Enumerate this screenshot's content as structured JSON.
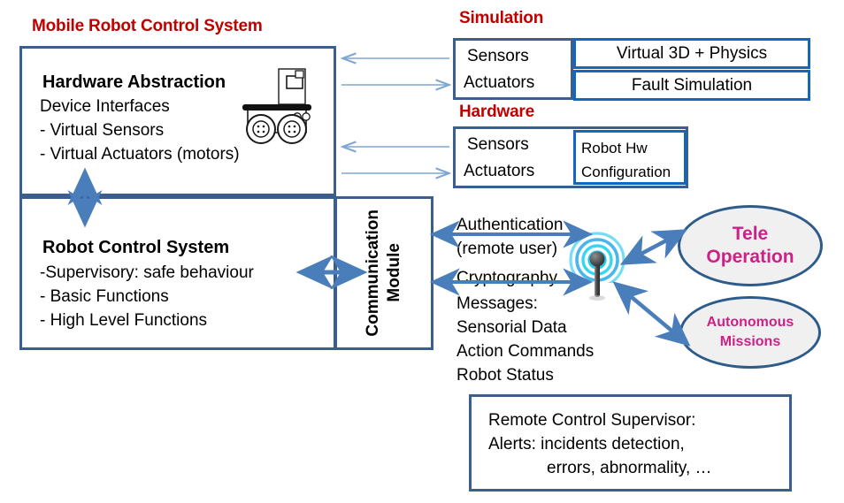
{
  "headings": {
    "mobile_robot": "Mobile Robot Control System",
    "simulation": "Simulation",
    "hardware": "Hardware"
  },
  "hardware_abstraction": {
    "title": "Hardware Abstraction",
    "line1": "Device Interfaces",
    "line2": "- Virtual Sensors",
    "line3": "- Virtual Actuators (motors)"
  },
  "robot_control": {
    "title": "Robot Control System",
    "line1": "-Supervisory: safe behaviour",
    "line2": "- Basic Functions",
    "line3": "- High Level Functions"
  },
  "communication_module": {
    "label": "Communication\nModule",
    "label_line1": "Communication",
    "label_line2": "Module"
  },
  "simulation_block": {
    "io_line1": "Sensors",
    "io_line2": "Actuators",
    "item1": "Virtual 3D + Physics",
    "item2": "Fault  Simulation"
  },
  "hardware_block": {
    "io_line1": "Sensors",
    "io_line2": "Actuators",
    "config_line1": "Robot  Hw",
    "config_line2": "Configuration"
  },
  "comms_labels": {
    "auth_line1": "Authentication",
    "auth_line2": "(remote  user)",
    "crypto": "Cryptography",
    "messages": " Messages:",
    "msg1": "Sensorial Data",
    "msg2": "Action Commands",
    "msg3": "Robot Status"
  },
  "ellipses": {
    "tele_line1": "Tele",
    "tele_line2": "Operation",
    "auto_line1": "Autonomous",
    "auto_line2": "Missions"
  },
  "supervisor_box": {
    "line1": "Remote Control Supervisor:",
    "line2": "Alerts: incidents detection,",
    "line3": "errors, abnormality, …"
  },
  "icons": {
    "robot": "mobile-robot-icon",
    "antenna": "wireless-antenna-icon"
  },
  "colors": {
    "heading_red": "#C00000",
    "box_dark_blue": "#3A5F8F",
    "box_bright_blue": "#1268BE",
    "arrow_blue": "#4A7EBB",
    "arrow_light_blue": "#8FB3DC",
    "ellipse_text_magenta": "#CC2288",
    "ellipse_fill": "#F0F0F0"
  }
}
